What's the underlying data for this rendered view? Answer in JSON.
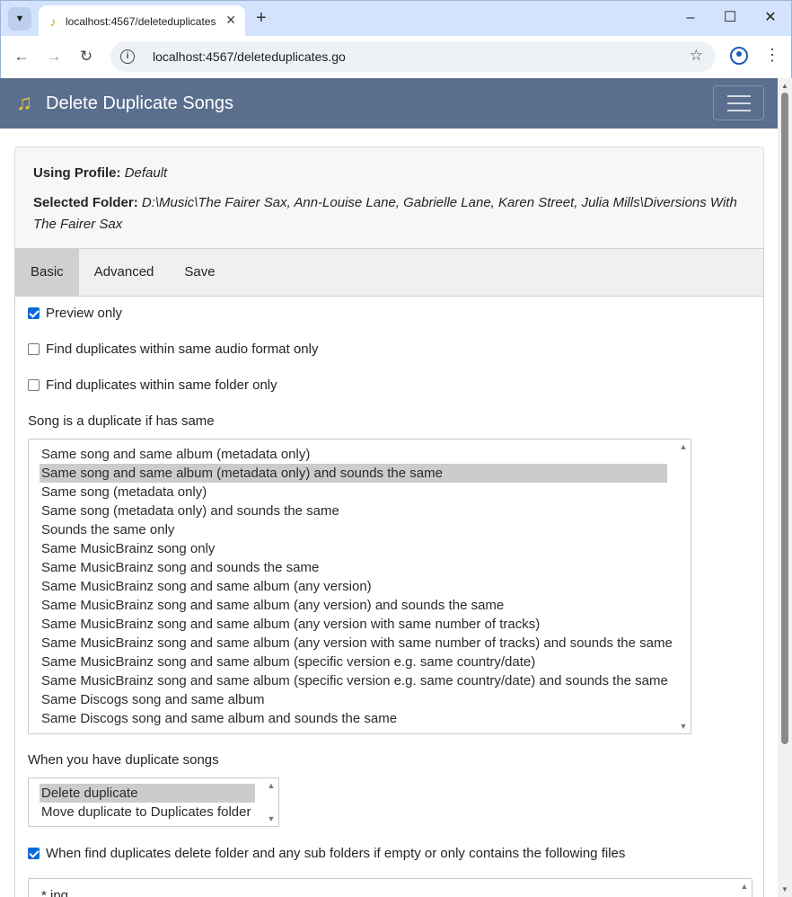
{
  "browser": {
    "tab_title": "localhost:4567/deleteduplicates",
    "url": "localhost:4567/deleteduplicates.go",
    "new_tab_label": "+",
    "minimize_label": "–",
    "maximize_label": "☐",
    "close_label": "✕"
  },
  "navbar": {
    "title": "Delete Duplicate Songs",
    "logo_icon": "music-note-icon"
  },
  "info": {
    "profile_label": "Using Profile:",
    "profile_value": "Default",
    "folder_label": "Selected Folder:",
    "folder_value": "D:\\Music\\The Fairer Sax, Ann-Louise Lane, Gabrielle Lane, Karen Street, Julia Mills\\Diversions With The Fairer Sax"
  },
  "tabs": [
    {
      "label": "Basic",
      "active": true
    },
    {
      "label": "Advanced",
      "active": false
    },
    {
      "label": "Save",
      "active": false
    }
  ],
  "options": {
    "preview_only": {
      "label": "Preview only",
      "checked": true
    },
    "same_format": {
      "label": "Find duplicates within same audio format only",
      "checked": false
    },
    "same_folder": {
      "label": "Find duplicates within same folder only",
      "checked": false
    }
  },
  "duplicate_criteria": {
    "label": "Song is a duplicate if has same",
    "selected_index": 1,
    "items": [
      "Same song and same album (metadata only)",
      "Same song and same album (metadata only) and sounds the same",
      "Same song (metadata only)",
      "Same song (metadata only) and sounds the same",
      "Sounds the same only",
      "Same MusicBrainz song only",
      "Same MusicBrainz song and sounds the same",
      "Same MusicBrainz song and same album (any version)",
      "Same MusicBrainz song and same album (any version) and sounds the same",
      "Same MusicBrainz song and same album (any version with same number of tracks)",
      "Same MusicBrainz song and same album (any version with same number of tracks) and sounds the same",
      "Same MusicBrainz song and same album (specific version e.g. same country/date)",
      "Same MusicBrainz song and same album (specific version e.g. same country/date) and sounds the same",
      "Same Discogs song and same album",
      "Same Discogs song and same album and sounds the same"
    ]
  },
  "duplicate_action": {
    "label": "When you have duplicate songs",
    "selected_index": 0,
    "items": [
      "Delete duplicate",
      "Move duplicate to Duplicates folder"
    ]
  },
  "delete_folder": {
    "label": "When find duplicates delete folder and any sub folders if empty or only contains the following files",
    "checked": true,
    "files_value": "*.jpg"
  }
}
